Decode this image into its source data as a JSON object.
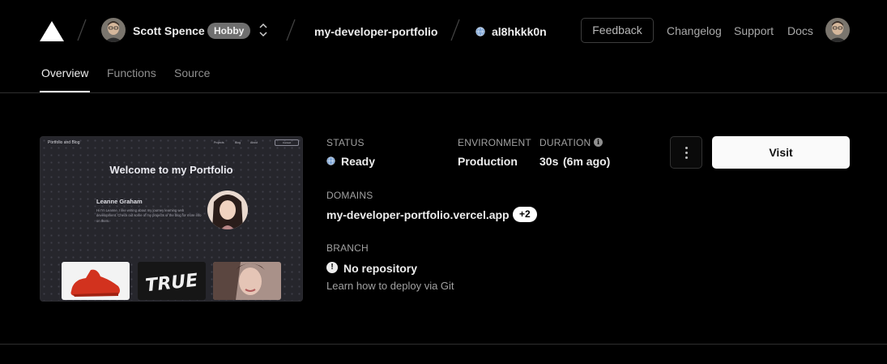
{
  "header": {
    "user_name": "Scott Spence",
    "plan_badge": "Hobby",
    "project_name": "my-developer-portfolio",
    "deployment_id": "al8hkkk0n",
    "feedback_label": "Feedback",
    "links": [
      "Changelog",
      "Support",
      "Docs"
    ]
  },
  "tabs": [
    "Overview",
    "Functions",
    "Source"
  ],
  "active_tab": "Overview",
  "preview": {
    "site_brand": "Portfolio and Blog",
    "nav_links": [
      "Projects",
      "Blog",
      "About"
    ],
    "nav_cta": "Contact",
    "heading": "Welcome to my Portfolio",
    "author_name": "Leanne Graham",
    "bio": "Hi I'm Leanne, I like writing about my journey learning web development. Check out some of my projects or the blog for more info on them.",
    "thumb_text": "TRUE"
  },
  "deployment": {
    "status_label": "STATUS",
    "status_value": "Ready",
    "environment_label": "ENVIRONMENT",
    "environment_value": "Production",
    "duration_label": "DURATION",
    "duration_value": "30s",
    "duration_ago": "(6m ago)",
    "domains_label": "DOMAINS",
    "domain": "my-developer-portfolio.vercel.app",
    "domain_extra": "+2",
    "branch_label": "BRANCH",
    "branch_value": "No repository",
    "learn_link": "Learn how to deploy via Git",
    "visit_label": "Visit"
  },
  "colors": {
    "background": "#000000",
    "text": "#ededed",
    "muted": "#a1a1a1",
    "ready_blue": "#8fb3e0"
  },
  "icons": [
    "vercel-logo-icon",
    "chevron-updown-icon",
    "globe-icon",
    "info-icon",
    "ellipsis-vertical-icon",
    "alert-circle-icon"
  ]
}
